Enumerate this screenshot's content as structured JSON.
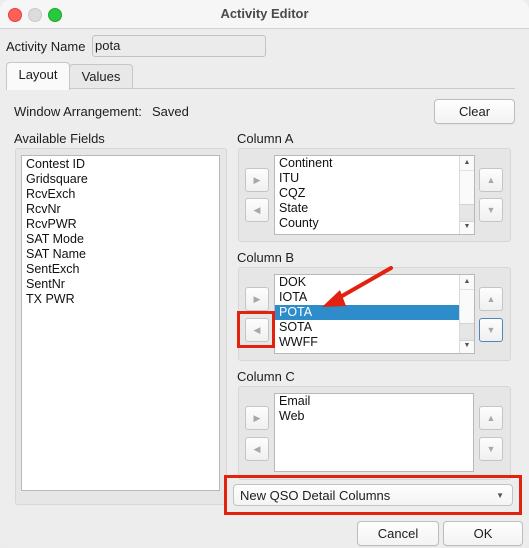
{
  "window": {
    "title": "Activity Editor"
  },
  "activity_name": {
    "label": "Activity Name",
    "value": "pota"
  },
  "tabs": [
    {
      "label": "Layout",
      "active": true
    },
    {
      "label": "Values",
      "active": false
    }
  ],
  "layout": {
    "window_arrangement_label": "Window Arrangement:",
    "window_arrangement_value": "Saved",
    "clear_label": "Clear",
    "available_fields": {
      "label": "Available Fields",
      "items": [
        "Contest ID",
        "Gridsquare",
        "RcvExch",
        "RcvNr",
        "RcvPWR",
        "SAT Mode",
        "SAT Name",
        "SentExch",
        "SentNr",
        "TX PWR"
      ]
    },
    "column_a": {
      "label": "Column A",
      "items": [
        "Continent",
        "ITU",
        "CQZ",
        "State",
        "County"
      ]
    },
    "column_b": {
      "label": "Column B",
      "items": [
        "DOK",
        "IOTA",
        "POTA",
        "SOTA",
        "WWFF"
      ],
      "selected": "POTA"
    },
    "column_c": {
      "label": "Column C",
      "items": [
        "Email",
        "Web"
      ]
    },
    "icons": {
      "move_right": "▶",
      "move_left": "◀",
      "move_up": "▲",
      "move_down": "▼",
      "scroll_up": "▲",
      "scroll_down": "▼",
      "dropdown": "▼"
    },
    "detail_columns_dropdown": {
      "selected": "New QSO Detail Columns"
    }
  },
  "footer": {
    "cancel_label": "Cancel",
    "ok_label": "OK"
  },
  "annotations": {
    "color": "#e3210f"
  }
}
